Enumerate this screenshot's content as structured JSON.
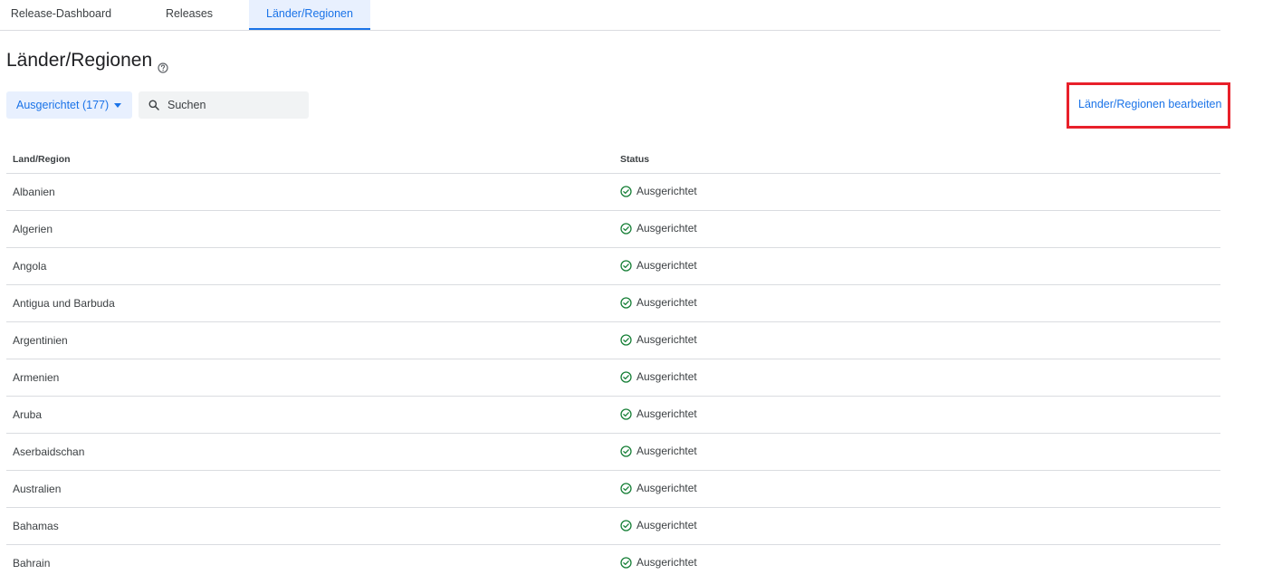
{
  "tabs": [
    {
      "label": "Release-Dashboard",
      "active": false
    },
    {
      "label": "Releases",
      "active": false
    },
    {
      "label": "Länder/Regionen",
      "active": true
    }
  ],
  "page": {
    "title": "Länder/Regionen",
    "help_icon": "help-circle-icon"
  },
  "toolbar": {
    "filter_label": "Ausgerichtet (177)",
    "search_placeholder": "Suchen",
    "search_value": "",
    "edit_link_label": "Länder/Regionen bearbeiten"
  },
  "table": {
    "columns": [
      "Land/Region",
      "Status"
    ],
    "rows": [
      {
        "country": "Albanien",
        "status": "Ausgerichtet"
      },
      {
        "country": "Algerien",
        "status": "Ausgerichtet"
      },
      {
        "country": "Angola",
        "status": "Ausgerichtet"
      },
      {
        "country": "Antigua und Barbuda",
        "status": "Ausgerichtet"
      },
      {
        "country": "Argentinien",
        "status": "Ausgerichtet"
      },
      {
        "country": "Armenien",
        "status": "Ausgerichtet"
      },
      {
        "country": "Aruba",
        "status": "Ausgerichtet"
      },
      {
        "country": "Aserbaidschan",
        "status": "Ausgerichtet"
      },
      {
        "country": "Australien",
        "status": "Ausgerichtet"
      },
      {
        "country": "Bahamas",
        "status": "Ausgerichtet"
      },
      {
        "country": "Bahrain",
        "status": "Ausgerichtet"
      }
    ]
  },
  "colors": {
    "accent": "#1a73e8",
    "status_ok": "#188038",
    "highlight_frame": "#e8202a"
  }
}
